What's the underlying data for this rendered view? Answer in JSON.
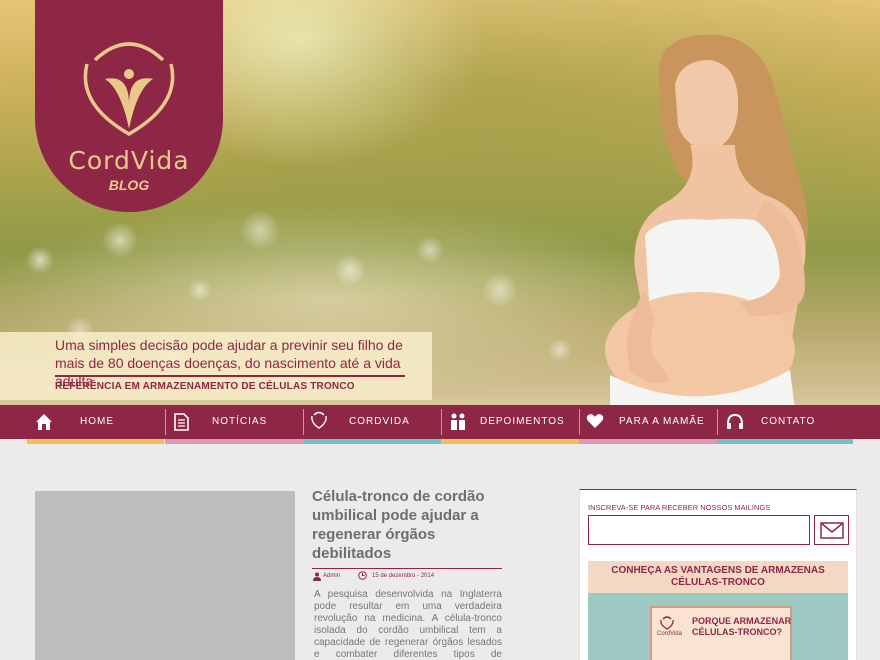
{
  "brand": {
    "name_light": "Cord",
    "name_bold": "Vida",
    "sub": "BLOG"
  },
  "hero": {
    "tagline": "Uma simples decisão pode ajudar a previnir seu filho de mais de 80 doenças doenças, do nascimento até a vida adulta.",
    "reference": "REFERÊNCIA EM ARMAZENAMENTO DE CÉLULAS TRONCO"
  },
  "nav": {
    "items": [
      {
        "label": "HOME",
        "icon": "home-icon",
        "underline": "#e9c25d"
      },
      {
        "label": "NOTÍCIAS",
        "icon": "document-icon",
        "underline": "#d79cb7"
      },
      {
        "label": "CORDVIDA",
        "icon": "cordvida-icon",
        "underline": "#6fc3c8"
      },
      {
        "label": "DEPOIMENTOS",
        "icon": "people-icon",
        "underline": "#e9c25d"
      },
      {
        "label": "PARA A MAMÃE",
        "icon": "heart-icon",
        "underline": "#d79cb7"
      },
      {
        "label": "CONTATO",
        "icon": "headset-icon",
        "underline": "#6fc3c8"
      }
    ]
  },
  "post": {
    "title": "Célula-tronco de cordão umbilical pode ajudar a regenerar órgãos debilitados",
    "author": "Admin",
    "date": "15 de dezembro - 2014",
    "excerpt": "A pesquisa desenvolvida na Inglaterra pode resultar em uma verdadeira revolução na medicina. A célula-tronco isolada do cordão umbilical tem a capacidade de regenerar órgãos lesados e combater diferentes tipos de inflamações."
  },
  "sidebar": {
    "subscribe_label": "INSCREVA-SE  PARA RECEBER NOSSOS MAILINGS",
    "email_placeholder": "",
    "promo_title": "CONHEÇA AS VANTAGENS DE ARMAZENAS CÉLULAS-TRONCO",
    "book_title": "PORQUE ARMAZENAR CÉLULAS-TRONCO?",
    "book_brand": "CordVida"
  },
  "colors": {
    "brand": "#8e2745",
    "gold": "#e8c98a"
  }
}
